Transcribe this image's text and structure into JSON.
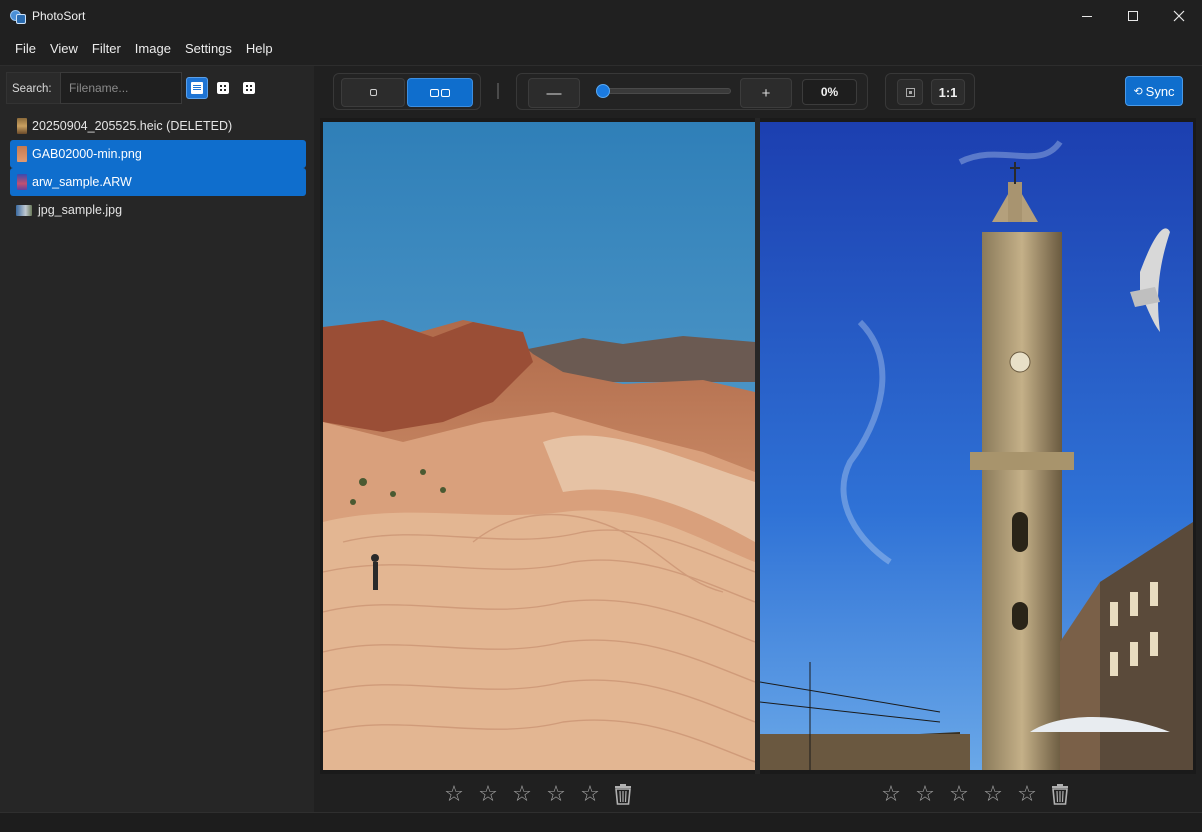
{
  "window": {
    "title": "PhotoSort",
    "controls": [
      "minimize",
      "maximize",
      "close"
    ]
  },
  "menu": [
    "File",
    "View",
    "Filter",
    "Image",
    "Settings",
    "Help"
  ],
  "sidebar": {
    "search_label": "Search:",
    "search_placeholder": "Filename...",
    "search_value": "",
    "view_modes": [
      {
        "icon": "list-view-icon",
        "active": true
      },
      {
        "icon": "grid-view-icon",
        "active": false
      },
      {
        "icon": "grid-large-view-icon",
        "active": false
      }
    ],
    "files": [
      {
        "name": "20250904_205525.heic (DELETED)",
        "selected": false
      },
      {
        "name": "GAB02000-min.png",
        "selected": true
      },
      {
        "name": "arw_sample.ARW",
        "selected": true
      },
      {
        "name": "jpg_sample.jpg",
        "selected": false
      }
    ]
  },
  "toolbar": {
    "view_mode": {
      "single_icon": "single-view-icon",
      "dual_icon": "side-by-side-icon",
      "active": "dual"
    },
    "zoom": {
      "out_label": "—",
      "in_label": "+",
      "percent_label": "0%",
      "level": 0
    },
    "fit_icon": "fit-to-window-icon",
    "actual_size_label": "1:1",
    "sync_label": "Sync",
    "sync_icon": "sync-icon"
  },
  "viewer": {
    "left_image": "desert-sandstone-landscape",
    "right_image": "clerigos-tower-with-seagull"
  },
  "ratings": {
    "left": {
      "stars": 5,
      "filled": 0,
      "star_glyph": "☆",
      "trash_icon": "trash-icon"
    },
    "right": {
      "stars": 5,
      "filled": 0,
      "star_glyph": "☆",
      "trash_icon": "trash-icon"
    }
  },
  "colors": {
    "accent": "#0f6ecd",
    "background": "#202020",
    "sidebar": "#262626"
  }
}
